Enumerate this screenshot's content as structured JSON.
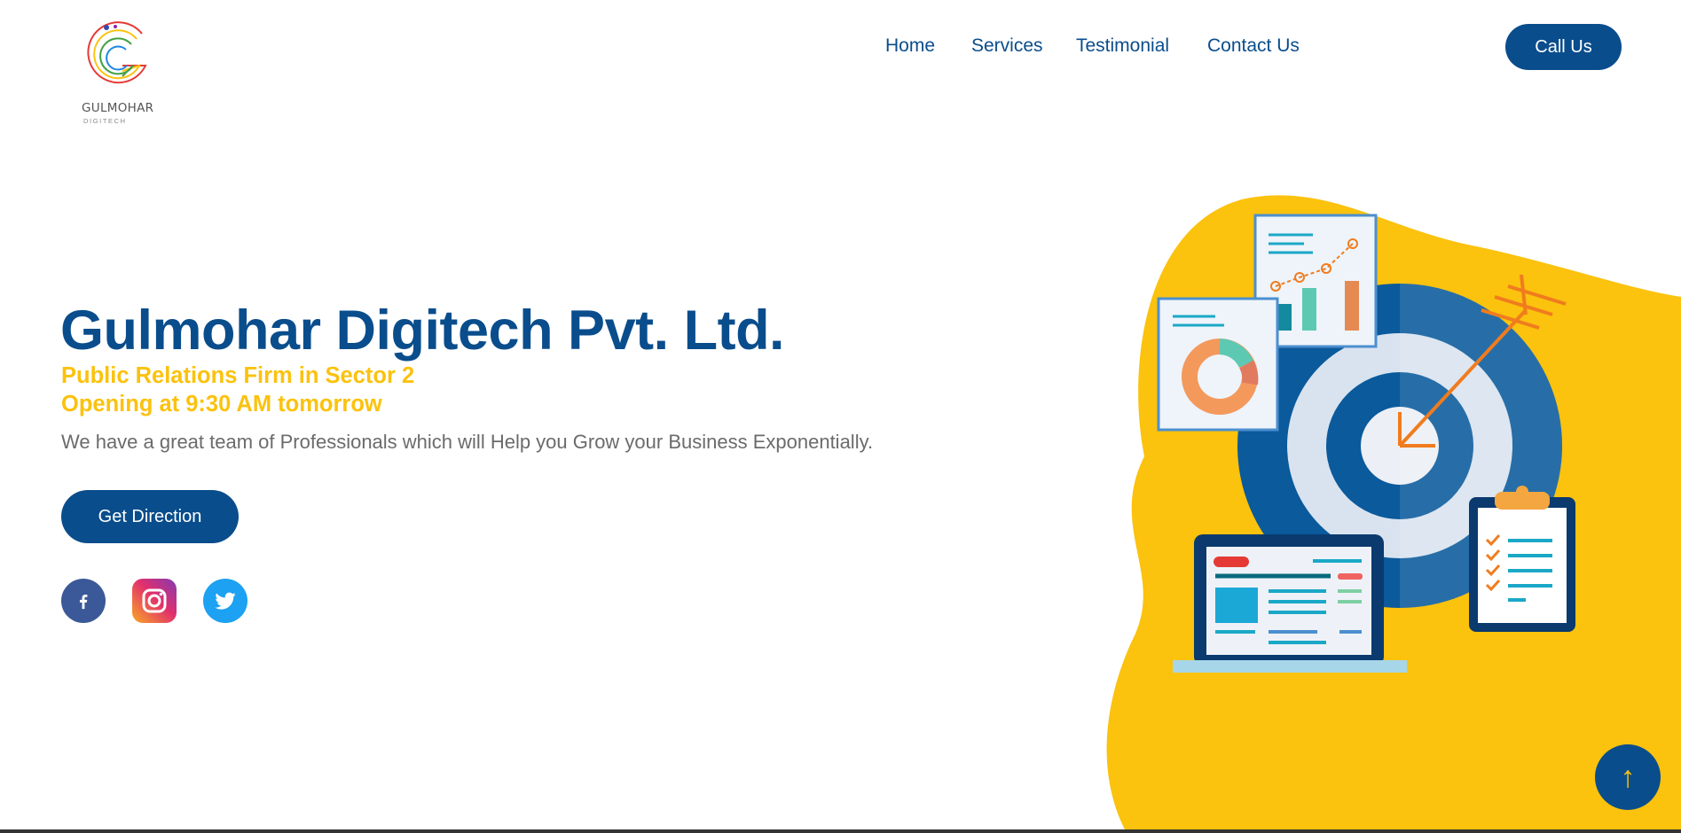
{
  "brand": {
    "name": "GULMOHAR",
    "tagline": "DIGITECH"
  },
  "nav": {
    "items": [
      {
        "label": "Home"
      },
      {
        "label": "Services"
      },
      {
        "label": "Testimonial"
      },
      {
        "label": "Contact Us"
      }
    ],
    "cta_label": "Call Us"
  },
  "hero": {
    "title": "Gulmohar Digitech Pvt. Ltd.",
    "subtitle_1": "Public Relations Firm in Sector 2",
    "subtitle_2": "Opening at 9:30 AM tomorrow",
    "description": "We have a great team of Professionals which will Help you Grow your Business Exponentially.",
    "cta_label": "Get Direction"
  },
  "social": [
    {
      "icon": "facebook-icon",
      "color": "#3b5998"
    },
    {
      "icon": "instagram-icon",
      "color": "#e1306c"
    },
    {
      "icon": "twitter-icon",
      "color": "#1da1f2"
    }
  ],
  "scroll_top": {
    "icon": "arrow-up-icon",
    "glyph": "↑"
  },
  "colors": {
    "primary": "#0a4d8c",
    "accent": "#fbc20e",
    "text_muted": "#6b6b6b",
    "background": "#ffffff"
  }
}
